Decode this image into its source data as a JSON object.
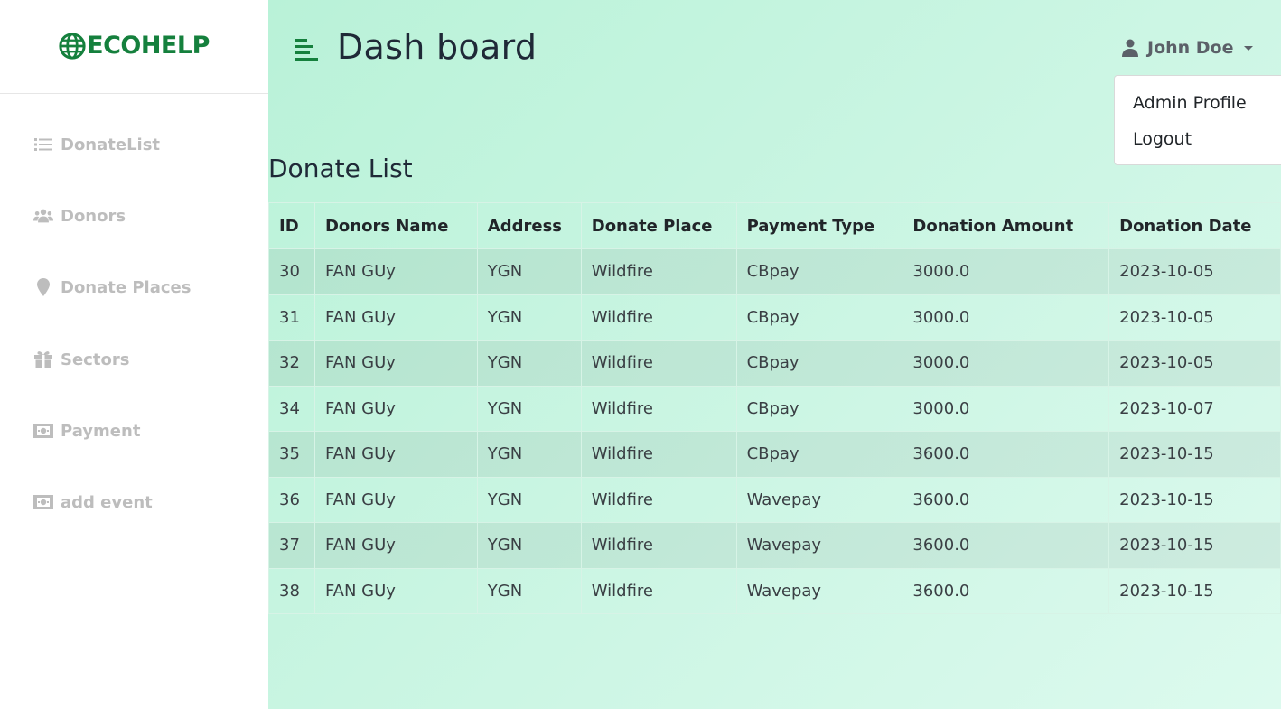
{
  "brand": {
    "name": "ECOHELP",
    "color": "#15803d"
  },
  "sidebar": {
    "items": [
      {
        "label": "DonateList",
        "icon": "list-icon"
      },
      {
        "label": "Donors",
        "icon": "users-icon"
      },
      {
        "label": "Donate Places",
        "icon": "map-pin-icon"
      },
      {
        "label": "Sectors",
        "icon": "gift-icon"
      },
      {
        "label": "Payment",
        "icon": "money-bill-icon"
      },
      {
        "label": "add event",
        "icon": "money-bill-icon"
      }
    ]
  },
  "header": {
    "title": "Dash board",
    "user_name": "John Doe",
    "dropdown": [
      "Admin Profile",
      "Logout"
    ]
  },
  "section": {
    "title": "Donate List"
  },
  "table": {
    "columns": [
      "ID",
      "Donors Name",
      "Address",
      "Donate Place",
      "Payment Type",
      "Donation Amount",
      "Donation Date"
    ],
    "rows": [
      [
        "30",
        "FAN GUy",
        "YGN",
        "Wildfire",
        "CBpay",
        "3000.0",
        "2023-10-05"
      ],
      [
        "31",
        "FAN GUy",
        "YGN",
        "Wildfire",
        "CBpay",
        "3000.0",
        "2023-10-05"
      ],
      [
        "32",
        "FAN GUy",
        "YGN",
        "Wildfire",
        "CBpay",
        "3000.0",
        "2023-10-05"
      ],
      [
        "34",
        "FAN GUy",
        "YGN",
        "Wildfire",
        "CBpay",
        "3000.0",
        "2023-10-07"
      ],
      [
        "35",
        "FAN GUy",
        "YGN",
        "Wildfire",
        "CBpay",
        "3600.0",
        "2023-10-15"
      ],
      [
        "36",
        "FAN GUy",
        "YGN",
        "Wildfire",
        "Wavepay",
        "3600.0",
        "2023-10-15"
      ],
      [
        "37",
        "FAN GUy",
        "YGN",
        "Wildfire",
        "Wavepay",
        "3600.0",
        "2023-10-15"
      ],
      [
        "38",
        "FAN GUy",
        "YGN",
        "Wildfire",
        "Wavepay",
        "3600.0",
        "2023-10-15"
      ]
    ]
  },
  "colors": {
    "accent": "#15803d",
    "sidebar_text": "#bdbdbd",
    "main_bg": "#c9f5e2"
  }
}
